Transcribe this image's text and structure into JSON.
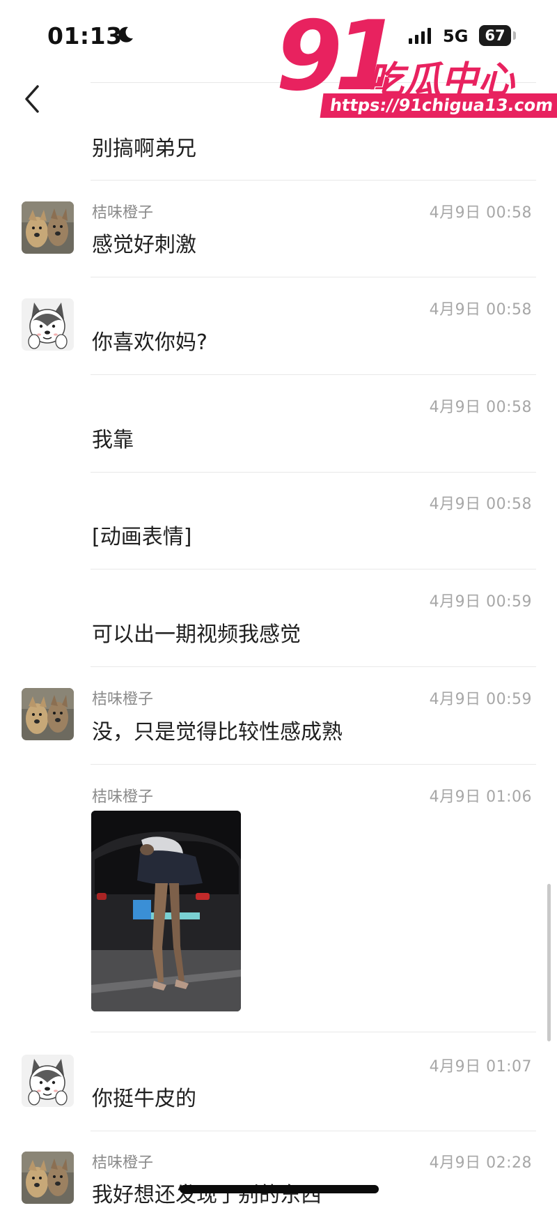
{
  "status_bar": {
    "time": "01:13",
    "network": "5G",
    "battery": "67"
  },
  "watermark": {
    "number": "91",
    "title": "吃瓜中心",
    "url": "https://91chigua13.com",
    "color": "#e8225f"
  },
  "icons": {
    "back": "chevron-left-icon",
    "moon": "moon-icon",
    "signal": "signal-icon"
  },
  "messages": [
    {
      "sender": "",
      "time": "",
      "text": "别搞啊弟兄",
      "avatar": ""
    },
    {
      "sender": "桔味橙子",
      "time": "4月9日 00:58",
      "text": "感觉好刺激",
      "avatar": "dogs"
    },
    {
      "sender": "",
      "time": "4月9日 00:58",
      "text": "你喜欢你妈?",
      "avatar": "husky-cartoon"
    },
    {
      "sender": "",
      "time": "4月9日 00:58",
      "text": "我靠",
      "avatar": ""
    },
    {
      "sender": "",
      "time": "4月9日 00:58",
      "text": "[动画表情]",
      "avatar": ""
    },
    {
      "sender": "",
      "time": "4月9日 00:59",
      "text": "可以出一期视频我感觉",
      "avatar": ""
    },
    {
      "sender": "桔味橙子",
      "time": "4月9日 00:59",
      "text": "没，只是觉得比较性感成熟",
      "avatar": "dogs"
    },
    {
      "sender": "桔味橙子",
      "time": "4月9日 01:06",
      "text": "",
      "avatar": "",
      "image": "photo"
    },
    {
      "sender": "",
      "time": "4月9日 01:07",
      "text": "你挺牛皮的",
      "avatar": "husky-cartoon"
    },
    {
      "sender": "桔味橙子",
      "time": "4月9日 02:28",
      "text": "我好想还发现了别的东西",
      "avatar": "dogs"
    }
  ]
}
